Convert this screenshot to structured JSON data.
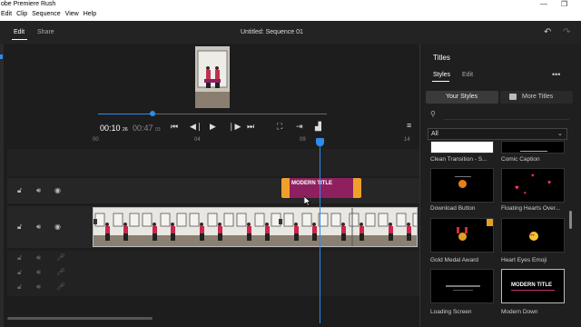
{
  "app": {
    "title": "obe Premiere Rush"
  },
  "menu": [
    "Edit",
    "Clip",
    "Sequence",
    "View",
    "Help"
  ],
  "header": {
    "tab_edit": "Edit",
    "tab_share": "Share",
    "sequence_title": "Untitled: Sequence 01"
  },
  "player": {
    "current_time": "00:10",
    "current_frames": "26",
    "total_time": "00:47",
    "total_frames": "03",
    "progress": 0.24
  },
  "ruler": {
    "labels": [
      "00",
      "04",
      "09",
      "14"
    ]
  },
  "titles_panel": {
    "heading": "Titles",
    "tab_styles": "Styles",
    "tab_edit": "Edit",
    "more_icon": "more-horizontal-icon",
    "your_styles": "Your Styles",
    "more_titles": "More Titles",
    "filter_value": "All",
    "items": [
      {
        "label": "Clean Transition - S..."
      },
      {
        "label": "Comic Caption"
      },
      {
        "label": "Download Button"
      },
      {
        "label": "Floating Hearts Over..."
      },
      {
        "label": "Gold Medal Award"
      },
      {
        "label": "Heart Eyes Emoji"
      },
      {
        "label": "Loading Screen"
      },
      {
        "label": "Modern Down"
      }
    ],
    "thumb_texts": {
      "modern_title": "MODERN TITLE"
    }
  },
  "timeline": {
    "title_clip_label": "MODERN TITLE"
  },
  "colors": {
    "accent": "#2d8ceb",
    "title_clip": "#8e2060",
    "clip_handle": "#f0a02a"
  }
}
